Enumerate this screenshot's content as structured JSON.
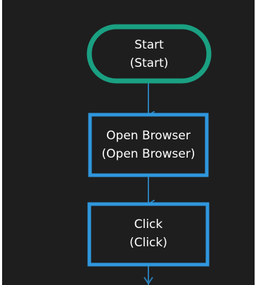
{
  "flowchart": {
    "colors": {
      "background": "#1e1e1e",
      "start_border": "#1aa082",
      "step_border": "#2f97dd",
      "connector": "#2a7db4",
      "text": "#ffffff"
    },
    "nodes": [
      {
        "id": "start",
        "shape": "terminal",
        "title": "Start",
        "subtitle": "(Start)"
      },
      {
        "id": "open-browser",
        "shape": "process",
        "title": "Open Browser",
        "subtitle": "(Open Browser)"
      },
      {
        "id": "click",
        "shape": "process",
        "title": "Click",
        "subtitle": "(Click)"
      }
    ]
  }
}
